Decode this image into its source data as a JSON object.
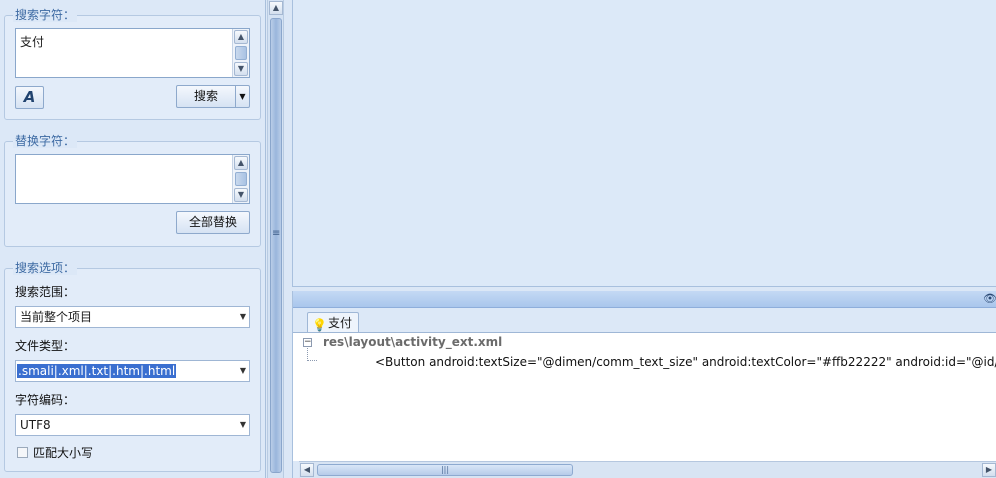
{
  "search_group": {
    "title": "搜索字符：",
    "query": "支付",
    "font_button_glyph": "A",
    "search_button": "搜索"
  },
  "replace_group": {
    "title": "替换字符：",
    "value": "",
    "replace_all_button": "全部替换"
  },
  "options_group": {
    "title": "搜索选项：",
    "scope_label": "搜索范围：",
    "scope_value": "当前整个项目",
    "filetype_label": "文件类型：",
    "filetype_value": ".smali|.xml|.txt|.htm|.html",
    "encoding_label": "字符编码：",
    "encoding_value": "UTF8",
    "match_case_label": "匹配大小写",
    "match_case_checked": false
  },
  "results": {
    "tab_label": "支付",
    "file_path": "res\\layout\\activity_ext.xml",
    "match_line": "<Button android:textSize=\"@dimen/comm_text_size\" android:textColor=\"#ffb22222\" android:id=\"@id/ext_p"
  },
  "icons": {
    "arrow_up": "▲",
    "arrow_down": "▼",
    "arrow_left": "◀",
    "arrow_right": "▶",
    "dropdown": "▼",
    "eye": "👁",
    "bulb": "💡",
    "grip": "≡",
    "thumb_grip": "|||",
    "tree_collapse": "−"
  }
}
